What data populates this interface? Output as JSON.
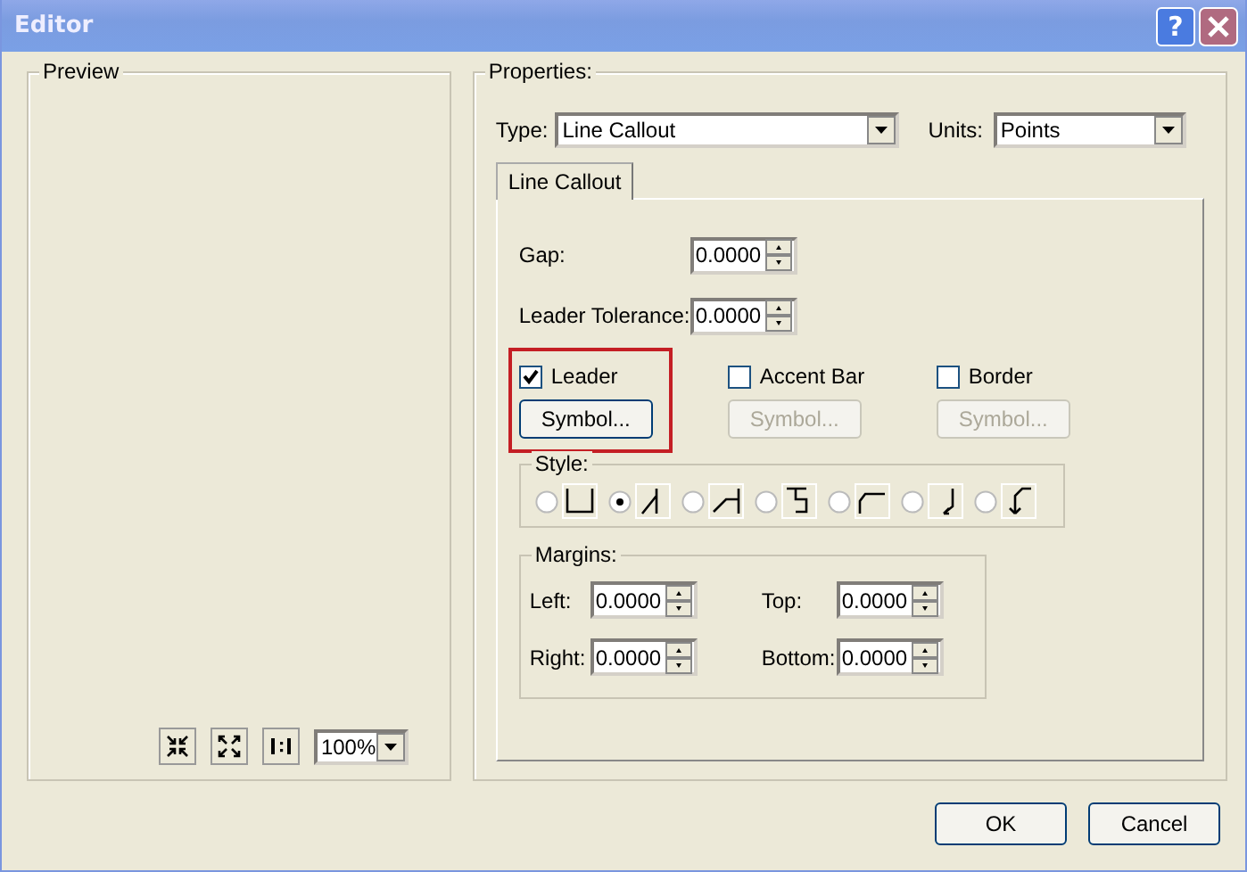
{
  "window": {
    "title": "Editor",
    "help": "?"
  },
  "preview": {
    "label": "Preview",
    "zoom": "100%"
  },
  "properties": {
    "label": "Properties:",
    "type_label": "Type:",
    "type": "Line Callout",
    "units_label": "Units:",
    "units": "Points",
    "tabs": [
      {
        "label": "Line Callout",
        "selected": true
      }
    ],
    "fields": [
      {
        "label": "Gap:",
        "value": "0.0000"
      },
      {
        "label": "Leader Tolerance:",
        "value": "0.0000"
      }
    ],
    "options": [
      {
        "label": "Leader",
        "checked": true,
        "button": "Symbol...",
        "disabled": false
      },
      {
        "label": "Accent Bar",
        "checked": false,
        "button": "Symbol...",
        "disabled": true
      },
      {
        "label": "Border",
        "checked": false,
        "button": "Symbol...",
        "disabled": true
      }
    ],
    "style": {
      "label": "Style:",
      "choices": [
        {
          "selected": false
        },
        {
          "selected": true
        },
        {
          "selected": false
        },
        {
          "selected": false
        },
        {
          "selected": false
        },
        {
          "selected": false
        },
        {
          "selected": false
        }
      ]
    },
    "margins": {
      "label": "Margins:",
      "fields": [
        {
          "label": "Left:",
          "value": "0.0000"
        },
        {
          "label": "Top:",
          "value": "0.0000"
        },
        {
          "label": "Right:",
          "value": "0.0000"
        },
        {
          "label": "Bottom:",
          "value": "0.0000"
        }
      ]
    }
  },
  "buttons": [
    "OK",
    "Cancel"
  ]
}
